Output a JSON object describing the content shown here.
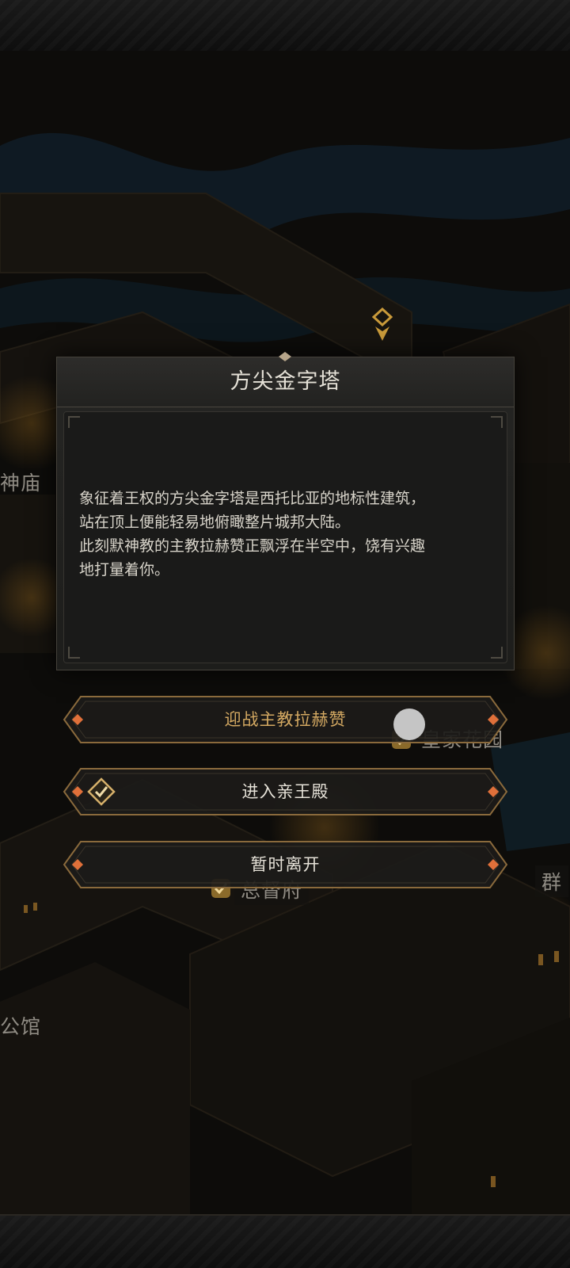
{
  "map": {
    "labels": {
      "temple": "神庙",
      "royal_garden": "皇家花园",
      "governor_mansion": "总督府",
      "left_bottom": "公馆",
      "right_edge": "群"
    }
  },
  "dialog": {
    "title": "方尖金字塔",
    "lines": [
      "象征着王权的方尖金字塔是西托比亚的地标性建筑，",
      "站在顶上便能轻易地俯瞰整片城邦大陆。",
      "此刻默神教的主教拉赫赞正飘浮在半空中，饶有兴趣",
      "地打量着你。"
    ]
  },
  "options": {
    "fight": "迎战主教拉赫赞",
    "enter": "进入亲王殿",
    "leave": "暂时离开"
  },
  "colors": {
    "gold_text": "#d4a962",
    "accent_orange": "#e0703a",
    "frame_gold": "#8a6a3c"
  }
}
